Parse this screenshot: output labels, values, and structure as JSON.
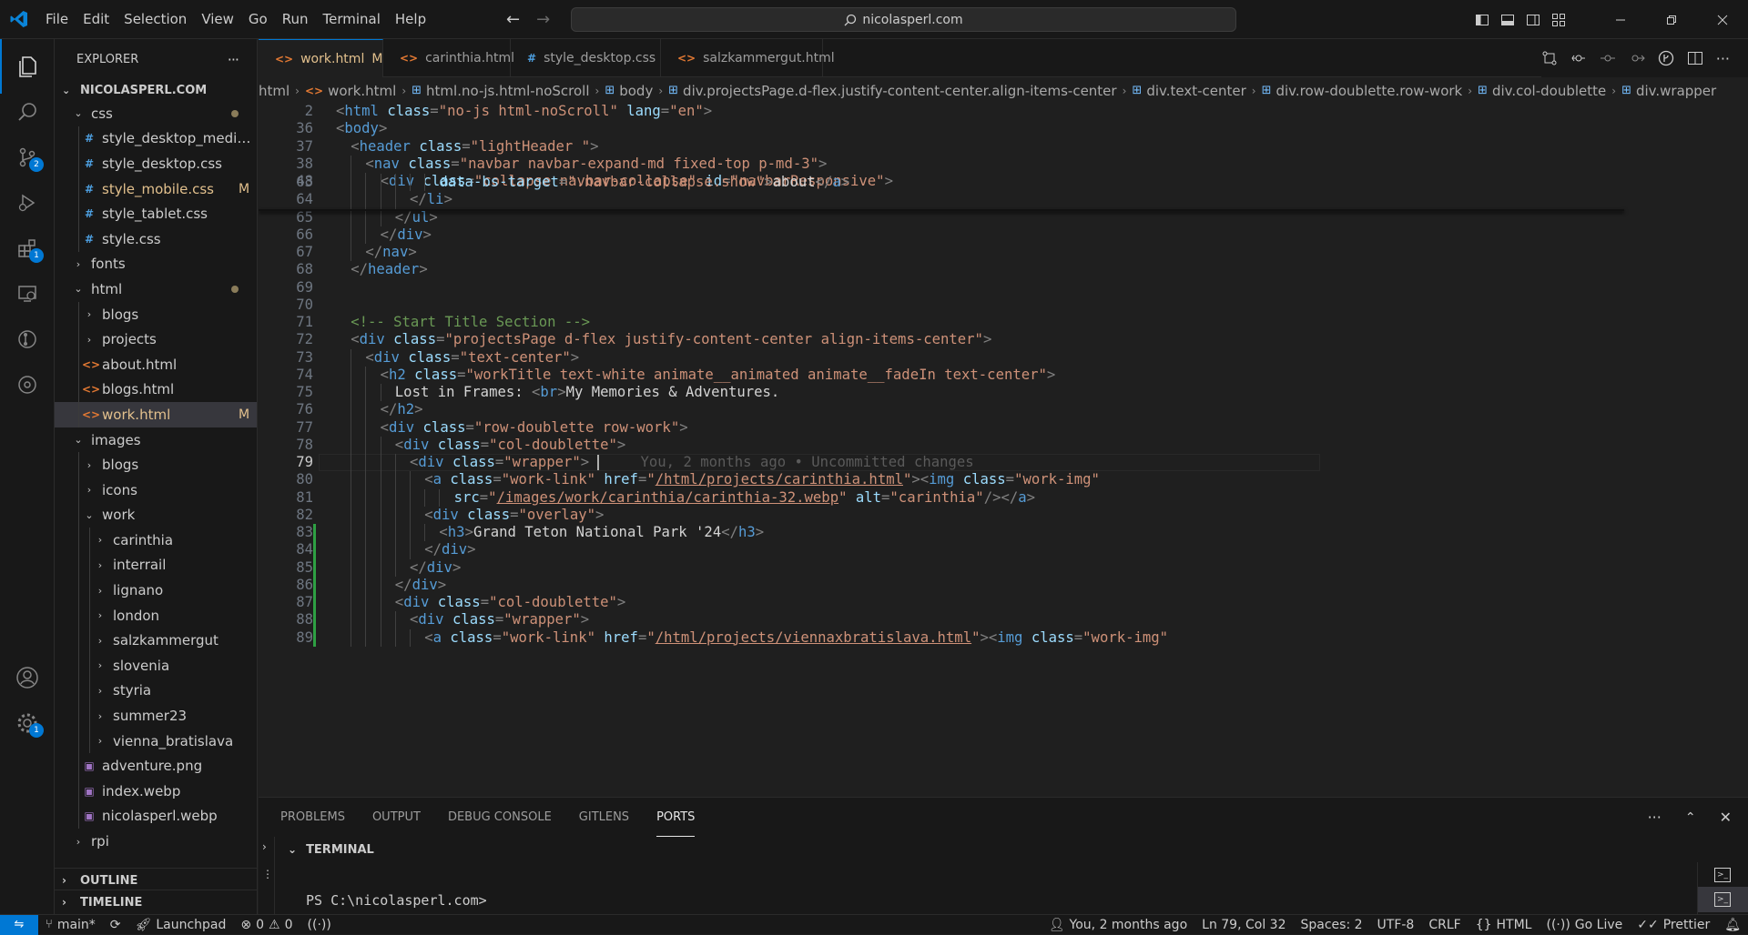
{
  "menu": [
    "File",
    "Edit",
    "Selection",
    "View",
    "Go",
    "Run",
    "Terminal",
    "Help"
  ],
  "search": {
    "text": "nicolasperl.com"
  },
  "activity": {
    "scm_badge": "2",
    "ext_badge": "1",
    "settings_badge": "1"
  },
  "explorer": {
    "title": "EXPLORER",
    "more": "···",
    "project": "NICOLASPERL.COM",
    "items": [
      {
        "label": "css",
        "type": "folder",
        "depth": 0,
        "open": true,
        "dot": true
      },
      {
        "label": "style_desktop_mediu...",
        "type": "css",
        "depth": 1
      },
      {
        "label": "style_desktop.css",
        "type": "css",
        "depth": 1
      },
      {
        "label": "style_mobile.css",
        "type": "css",
        "depth": 1,
        "status": "M"
      },
      {
        "label": "style_tablet.css",
        "type": "css",
        "depth": 1
      },
      {
        "label": "style.css",
        "type": "css",
        "depth": 1
      },
      {
        "label": "fonts",
        "type": "folder",
        "depth": 0,
        "open": false
      },
      {
        "label": "html",
        "type": "folder",
        "depth": 0,
        "open": true,
        "dot": true
      },
      {
        "label": "blogs",
        "type": "folder",
        "depth": 1,
        "open": false
      },
      {
        "label": "projects",
        "type": "folder",
        "depth": 1,
        "open": false
      },
      {
        "label": "about.html",
        "type": "html",
        "depth": 1
      },
      {
        "label": "blogs.html",
        "type": "html",
        "depth": 1
      },
      {
        "label": "work.html",
        "type": "html",
        "depth": 1,
        "status": "M",
        "selected": true
      },
      {
        "label": "images",
        "type": "folder",
        "depth": 0,
        "open": true
      },
      {
        "label": "blogs",
        "type": "folder",
        "depth": 1,
        "open": false
      },
      {
        "label": "icons",
        "type": "folder",
        "depth": 1,
        "open": false
      },
      {
        "label": "work",
        "type": "folder",
        "depth": 1,
        "open": true
      },
      {
        "label": "carinthia",
        "type": "folder",
        "depth": 2,
        "open": false
      },
      {
        "label": "interrail",
        "type": "folder",
        "depth": 2,
        "open": false
      },
      {
        "label": "lignano",
        "type": "folder",
        "depth": 2,
        "open": false
      },
      {
        "label": "london",
        "type": "folder",
        "depth": 2,
        "open": false
      },
      {
        "label": "salzkammergut",
        "type": "folder",
        "depth": 2,
        "open": false
      },
      {
        "label": "slovenia",
        "type": "folder",
        "depth": 2,
        "open": false
      },
      {
        "label": "styria",
        "type": "folder",
        "depth": 2,
        "open": false
      },
      {
        "label": "summer23",
        "type": "folder",
        "depth": 2,
        "open": false
      },
      {
        "label": "vienna_bratislava",
        "type": "folder",
        "depth": 2,
        "open": false
      },
      {
        "label": "adventure.png",
        "type": "img",
        "depth": 1
      },
      {
        "label": "index.webp",
        "type": "img",
        "depth": 1
      },
      {
        "label": "nicolasperl.webp",
        "type": "img",
        "depth": 1
      },
      {
        "label": "rpi",
        "type": "folder",
        "depth": 0,
        "open": false
      }
    ],
    "outline": "OUTLINE",
    "timeline": "TIMELINE"
  },
  "tabs": [
    {
      "label": "work.html",
      "status": "M",
      "icon": "html",
      "active": true
    },
    {
      "label": "carinthia.html",
      "icon": "html"
    },
    {
      "label": "style_desktop.css",
      "icon": "css"
    },
    {
      "label": "salzkammergut.html",
      "icon": "html"
    }
  ],
  "breadcrumb": [
    "html",
    "work.html",
    "html.no-js.html-noScroll",
    "body",
    "div.projectsPage.d-flex.justify-content-center.align-items-center",
    "div.text-center",
    "div.row-doublette.row-work",
    "div.col-doublette",
    "div.wrapper"
  ],
  "sticky": [
    {
      "n": "2",
      "indent": 0,
      "tokens": [
        [
          "t",
          "<"
        ],
        [
          "tg",
          "html"
        ],
        [
          "tx",
          " "
        ],
        [
          "at",
          "class"
        ],
        [
          "t",
          "="
        ],
        [
          "sv",
          "\"no-js html-noScroll\""
        ],
        [
          "tx",
          " "
        ],
        [
          "at",
          "lang"
        ],
        [
          "t",
          "="
        ],
        [
          "sv",
          "\"en\""
        ],
        [
          "t",
          ">"
        ]
      ]
    },
    {
      "n": "36",
      "indent": 0,
      "tokens": [
        [
          "t",
          "<"
        ],
        [
          "tg",
          "body"
        ],
        [
          "t",
          ">"
        ]
      ]
    },
    {
      "n": "37",
      "indent": 1,
      "tokens": [
        [
          "t",
          "<"
        ],
        [
          "tg",
          "header"
        ],
        [
          "tx",
          " "
        ],
        [
          "at",
          "class"
        ],
        [
          "t",
          "="
        ],
        [
          "sv",
          "\"lightHeader \""
        ],
        [
          "t",
          ">"
        ]
      ]
    },
    {
      "n": "38",
      "indent": 2,
      "tokens": [
        [
          "t",
          "<"
        ],
        [
          "tg",
          "nav"
        ],
        [
          "tx",
          " "
        ],
        [
          "at",
          "class"
        ],
        [
          "t",
          "="
        ],
        [
          "sv",
          "\"navbar navbar-expand-md fixed-top p-md-3\""
        ],
        [
          "t",
          ">"
        ]
      ]
    },
    {
      "n": "48",
      "indent": 3,
      "tokens": [
        [
          "t",
          "<"
        ],
        [
          "tg",
          "div"
        ],
        [
          "tx",
          " "
        ],
        [
          "at",
          "class"
        ],
        [
          "t",
          "="
        ],
        [
          "sv",
          "\"collapse navbar-collapse\""
        ],
        [
          "tx",
          " "
        ],
        [
          "at",
          "id"
        ],
        [
          "t",
          "="
        ],
        [
          "sv",
          "\"navbarResponsive\""
        ],
        [
          "t",
          ">"
        ]
      ]
    }
  ],
  "lines": [
    {
      "n": "63",
      "indent": 7,
      "tokens": [
        [
          "at",
          "data-bs-target"
        ],
        [
          "t",
          "="
        ],
        [
          "sv",
          "\".navbar-collapse.show\""
        ],
        [
          "t",
          ">"
        ],
        [
          "tx",
          "about"
        ],
        [
          "t",
          "</"
        ],
        [
          "tg",
          "a"
        ],
        [
          "t",
          ">"
        ]
      ]
    },
    {
      "n": "64",
      "indent": 5,
      "tokens": [
        [
          "t",
          "</"
        ],
        [
          "tg",
          "li"
        ],
        [
          "t",
          ">"
        ]
      ]
    },
    {
      "n": "65",
      "indent": 4,
      "tokens": [
        [
          "t",
          "</"
        ],
        [
          "tg",
          "ul"
        ],
        [
          "t",
          ">"
        ]
      ]
    },
    {
      "n": "66",
      "indent": 3,
      "tokens": [
        [
          "t",
          "</"
        ],
        [
          "tg",
          "div"
        ],
        [
          "t",
          ">"
        ]
      ]
    },
    {
      "n": "67",
      "indent": 2,
      "tokens": [
        [
          "t",
          "</"
        ],
        [
          "tg",
          "nav"
        ],
        [
          "t",
          ">"
        ]
      ]
    },
    {
      "n": "68",
      "indent": 1,
      "tokens": [
        [
          "t",
          "</"
        ],
        [
          "tg",
          "header"
        ],
        [
          "t",
          ">"
        ]
      ]
    },
    {
      "n": "69",
      "indent": 0,
      "tokens": []
    },
    {
      "n": "70",
      "indent": 0,
      "tokens": []
    },
    {
      "n": "71",
      "indent": 1,
      "tokens": [
        [
          "cm",
          "<!-- Start Title Section -->"
        ]
      ]
    },
    {
      "n": "72",
      "indent": 1,
      "tokens": [
        [
          "t",
          "<"
        ],
        [
          "tg",
          "div"
        ],
        [
          "tx",
          " "
        ],
        [
          "at",
          "class"
        ],
        [
          "t",
          "="
        ],
        [
          "sv",
          "\"projectsPage d-flex justify-content-center align-items-center\""
        ],
        [
          "t",
          ">"
        ]
      ]
    },
    {
      "n": "73",
      "indent": 2,
      "tokens": [
        [
          "t",
          "<"
        ],
        [
          "tg",
          "div"
        ],
        [
          "tx",
          " "
        ],
        [
          "at",
          "class"
        ],
        [
          "t",
          "="
        ],
        [
          "sv",
          "\"text-center\""
        ],
        [
          "t",
          ">"
        ]
      ]
    },
    {
      "n": "74",
      "indent": 3,
      "tokens": [
        [
          "t",
          "<"
        ],
        [
          "tg",
          "h2"
        ],
        [
          "tx",
          " "
        ],
        [
          "at",
          "class"
        ],
        [
          "t",
          "="
        ],
        [
          "sv",
          "\"workTitle text-white animate__animated animate__fadeIn text-center\""
        ],
        [
          "t",
          ">"
        ]
      ]
    },
    {
      "n": "75",
      "indent": 4,
      "tokens": [
        [
          "tx",
          "Lost in Frames: "
        ],
        [
          "t",
          "<"
        ],
        [
          "tg",
          "br"
        ],
        [
          "t",
          ">"
        ],
        [
          "tx",
          "My Memories & Adventures."
        ]
      ]
    },
    {
      "n": "76",
      "indent": 3,
      "tokens": [
        [
          "t",
          "</"
        ],
        [
          "tg",
          "h2"
        ],
        [
          "t",
          ">"
        ]
      ]
    },
    {
      "n": "77",
      "indent": 3,
      "tokens": [
        [
          "t",
          "<"
        ],
        [
          "tg",
          "div"
        ],
        [
          "tx",
          " "
        ],
        [
          "at",
          "class"
        ],
        [
          "t",
          "="
        ],
        [
          "sv",
          "\"row-doublette row-work\""
        ],
        [
          "t",
          ">"
        ]
      ]
    },
    {
      "n": "78",
      "indent": 4,
      "tokens": [
        [
          "t",
          "<"
        ],
        [
          "tg",
          "div"
        ],
        [
          "tx",
          " "
        ],
        [
          "at",
          "class"
        ],
        [
          "t",
          "="
        ],
        [
          "sv",
          "\"col-doublette\""
        ],
        [
          "t",
          ">"
        ]
      ]
    },
    {
      "n": "79",
      "indent": 5,
      "cur": true,
      "tokens": [
        [
          "t",
          "<"
        ],
        [
          "tg",
          "div"
        ],
        [
          "tx",
          " "
        ],
        [
          "at",
          "class"
        ],
        [
          "t",
          "="
        ],
        [
          "sv",
          "\"wrapper\""
        ],
        [
          "t",
          ">"
        ],
        [
          "blame",
          "      You, 2 months ago • Uncommitted changes"
        ]
      ]
    },
    {
      "n": "80",
      "indent": 6,
      "tokens": [
        [
          "t",
          "<"
        ],
        [
          "tg",
          "a"
        ],
        [
          "tx",
          " "
        ],
        [
          "at",
          "class"
        ],
        [
          "t",
          "="
        ],
        [
          "sv",
          "\"work-link\""
        ],
        [
          "tx",
          " "
        ],
        [
          "at",
          "href"
        ],
        [
          "t",
          "="
        ],
        [
          "sv",
          "\""
        ],
        [
          "lk",
          "/html/projects/carinthia.html"
        ],
        [
          "sv",
          "\""
        ],
        [
          "t",
          "><"
        ],
        [
          "tg",
          "img"
        ],
        [
          "tx",
          " "
        ],
        [
          "at",
          "class"
        ],
        [
          "t",
          "="
        ],
        [
          "sv",
          "\"work-img\""
        ]
      ]
    },
    {
      "n": "81",
      "indent": 8,
      "tokens": [
        [
          "at",
          "src"
        ],
        [
          "t",
          "="
        ],
        [
          "sv",
          "\""
        ],
        [
          "lk",
          "/images/work/carinthia/carinthia-32.webp"
        ],
        [
          "sv",
          "\""
        ],
        [
          "tx",
          " "
        ],
        [
          "at",
          "alt"
        ],
        [
          "t",
          "="
        ],
        [
          "sv",
          "\"carinthia\""
        ],
        [
          "t",
          "/></"
        ],
        [
          "tg",
          "a"
        ],
        [
          "t",
          ">"
        ]
      ]
    },
    {
      "n": "82",
      "indent": 6,
      "tokens": [
        [
          "t",
          "<"
        ],
        [
          "tg",
          "div"
        ],
        [
          "tx",
          " "
        ],
        [
          "at",
          "class"
        ],
        [
          "t",
          "="
        ],
        [
          "sv",
          "\"overlay\""
        ],
        [
          "t",
          ">"
        ]
      ]
    },
    {
      "n": "83",
      "indent": 7,
      "gb": true,
      "tokens": [
        [
          "t",
          "<"
        ],
        [
          "tg",
          "h3"
        ],
        [
          "t",
          ">"
        ],
        [
          "tx",
          "Grand Teton National Park '24"
        ],
        [
          "t",
          "</"
        ],
        [
          "tg",
          "h3"
        ],
        [
          "t",
          ">"
        ]
      ]
    },
    {
      "n": "84",
      "indent": 6,
      "gb": true,
      "tokens": [
        [
          "t",
          "</"
        ],
        [
          "tg",
          "div"
        ],
        [
          "t",
          ">"
        ]
      ]
    },
    {
      "n": "85",
      "indent": 5,
      "gb": true,
      "tokens": [
        [
          "t",
          "</"
        ],
        [
          "tg",
          "div"
        ],
        [
          "t",
          ">"
        ]
      ]
    },
    {
      "n": "86",
      "indent": 4,
      "gb": true,
      "tokens": [
        [
          "t",
          "</"
        ],
        [
          "tg",
          "div"
        ],
        [
          "t",
          ">"
        ]
      ]
    },
    {
      "n": "87",
      "indent": 4,
      "gb": true,
      "tokens": [
        [
          "t",
          "<"
        ],
        [
          "tg",
          "div"
        ],
        [
          "tx",
          " "
        ],
        [
          "at",
          "class"
        ],
        [
          "t",
          "="
        ],
        [
          "sv",
          "\"col-doublette\""
        ],
        [
          "t",
          ">"
        ]
      ]
    },
    {
      "n": "88",
      "indent": 5,
      "gb": true,
      "tokens": [
        [
          "t",
          "<"
        ],
        [
          "tg",
          "div"
        ],
        [
          "tx",
          " "
        ],
        [
          "at",
          "class"
        ],
        [
          "t",
          "="
        ],
        [
          "sv",
          "\"wrapper\""
        ],
        [
          "t",
          ">"
        ]
      ]
    },
    {
      "n": "89",
      "indent": 6,
      "gb": true,
      "tokens": [
        [
          "t",
          "<"
        ],
        [
          "tg",
          "a"
        ],
        [
          "tx",
          " "
        ],
        [
          "at",
          "class"
        ],
        [
          "t",
          "="
        ],
        [
          "sv",
          "\"work-link\""
        ],
        [
          "tx",
          " "
        ],
        [
          "at",
          "href"
        ],
        [
          "t",
          "="
        ],
        [
          "sv",
          "\""
        ],
        [
          "lk",
          "/html/projects/viennaxbratislava.html"
        ],
        [
          "sv",
          "\""
        ],
        [
          "t",
          "><"
        ],
        [
          "tg",
          "img"
        ],
        [
          "tx",
          " "
        ],
        [
          "at",
          "class"
        ],
        [
          "t",
          "="
        ],
        [
          "sv",
          "\"work-img\""
        ]
      ]
    }
  ],
  "panel": {
    "tabs": [
      "PROBLEMS",
      "OUTPUT",
      "DEBUG CONSOLE",
      "GITLENS",
      "PORTS"
    ],
    "active": "PORTS",
    "terminal_title": "TERMINAL",
    "prompt": "PS C:\\nicolasperl.com>"
  },
  "status": {
    "branch": "main*",
    "launchpad": "Launchpad",
    "errors": "0",
    "warnings": "0",
    "blame": "You, 2 months ago",
    "position": "Ln 79, Col 32",
    "spaces": "Spaces: 2",
    "encoding": "UTF-8",
    "eol": "CRLF",
    "language": "HTML",
    "golive": "Go Live",
    "prettier": "Prettier"
  }
}
